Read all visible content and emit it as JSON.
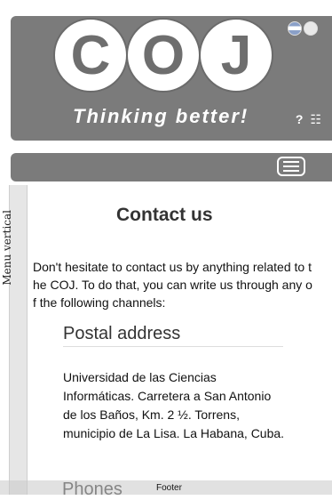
{
  "header": {
    "logo_letters": [
      "C",
      "O",
      "J"
    ],
    "tagline": "Thinking better!",
    "icons": [
      "help-icon",
      "sitemap-icon"
    ],
    "help_glyph": "?",
    "sitemap_glyph": "☷",
    "flags": [
      "flag-icon",
      "flag-icon"
    ]
  },
  "nav": {
    "menu_icon": "hamburger-icon"
  },
  "sidebar": {
    "vertical_menu_label": "Menu vertical"
  },
  "main": {
    "title": "Contact us",
    "intro": "Don't hesitate to contact us by anything related to the COJ. To do that, you can write us through any of the following channels:",
    "sections": [
      {
        "heading": "Postal address",
        "body": "Universidad de las Ciencias Informáticas. Carretera a San Antonio de los Baños, Km. 2 ½. Torrens, municipio de La Lisa. La Habana, Cuba."
      },
      {
        "heading": "Phones"
      }
    ]
  },
  "footer": {
    "label": "Footer"
  }
}
